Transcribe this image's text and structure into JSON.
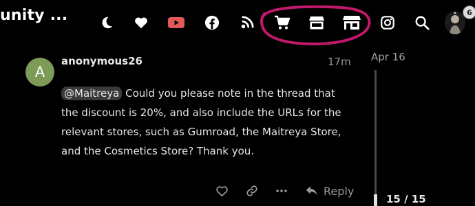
{
  "header": {
    "site_title": "unity ...",
    "icons": [
      "moon-icon",
      "heart-icon",
      "youtube-icon",
      "facebook-icon",
      "podcast-icon",
      "cart-icon",
      "store-icon",
      "shop-icon",
      "instagram-icon",
      "search-icon"
    ],
    "notification_count": "6",
    "annotation_color": "#c2186b",
    "youtube_color": "#e05a5a"
  },
  "post": {
    "avatar_letter": "A",
    "avatar_color": "#7d9a56",
    "username": "anonymous26",
    "time": "17m",
    "mention": "@Maitreya",
    "body": " Could you please note in the thread that the discount is 20%, and also include the URLs for the relevant stores, such as Gumroad, the Maitreya Store, and the Cosmetics Store? Thank you."
  },
  "actions": {
    "reply_label": "Reply"
  },
  "timeline": {
    "date": "Apr 16",
    "position": "15 / 15",
    "progress": 1.0
  }
}
